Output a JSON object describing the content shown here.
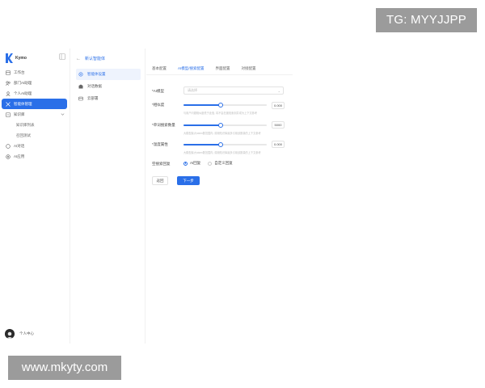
{
  "watermarks": {
    "top_right": "TG: MYYJJPP",
    "bottom_left": "www.mkyty.com"
  },
  "app": {
    "name": "Kymo"
  },
  "sidebar": {
    "items": [
      {
        "label": "工作台",
        "icon": "workbench-icon"
      },
      {
        "label": "部门AI助理",
        "icon": "team-icon"
      },
      {
        "label": "个人AI助理",
        "icon": "person-icon"
      },
      {
        "label": "智能体管理",
        "icon": "agent-icon",
        "active": true
      },
      {
        "label": "知识库",
        "icon": "knowledge-icon",
        "expandable": true
      },
      {
        "label": "知识库列表",
        "sub": true
      },
      {
        "label": "召回测试",
        "sub": true
      },
      {
        "label": "AI对话",
        "icon": "chat-icon"
      },
      {
        "label": "AI应用",
        "icon": "apps-icon"
      }
    ],
    "user": {
      "name": "个人中心"
    }
  },
  "sub_panel": {
    "back_label": "新认智能体",
    "items": [
      {
        "label": "智能体设置",
        "active": true
      },
      {
        "label": "对话数据"
      },
      {
        "label": "云部署"
      }
    ]
  },
  "main": {
    "tabs": [
      {
        "label": "基本配置"
      },
      {
        "label": "AI模型/搜索配置",
        "active": true
      },
      {
        "label": "界面配置"
      },
      {
        "label": "对接配置"
      }
    ],
    "form": {
      "model_label": "*AI模型",
      "model_placeholder": "请选择",
      "sliders": [
        {
          "label": "*相似度",
          "value_text": "0.000",
          "fraction": 0.45,
          "hint": "与用户问题相似度低于此值, 将不会在被检索到并成为上下文参考"
        },
        {
          "label": "*单词搜索数量",
          "value_text": "5000",
          "fraction": 0.45,
          "hint": "大模型最大token数范围内, 调用知识库最多引用该数量的上下文参考"
        },
        {
          "label": "*温度属性",
          "value_text": "0.000",
          "fraction": 0.45,
          "hint": "大模型最大token数范围内, 调用知识库最多引用该数量的上下文参考"
        }
      ],
      "empty_search_label": "空搜索回复",
      "radio_options": [
        {
          "label": "AI回复",
          "selected": true
        },
        {
          "label": "自定义回复",
          "selected": false
        }
      ],
      "cancel_label": "返回",
      "next_label": "下一步"
    }
  },
  "colors": {
    "accent": "#2a6fe8",
    "watermark_bg": "#9b9b9b"
  }
}
